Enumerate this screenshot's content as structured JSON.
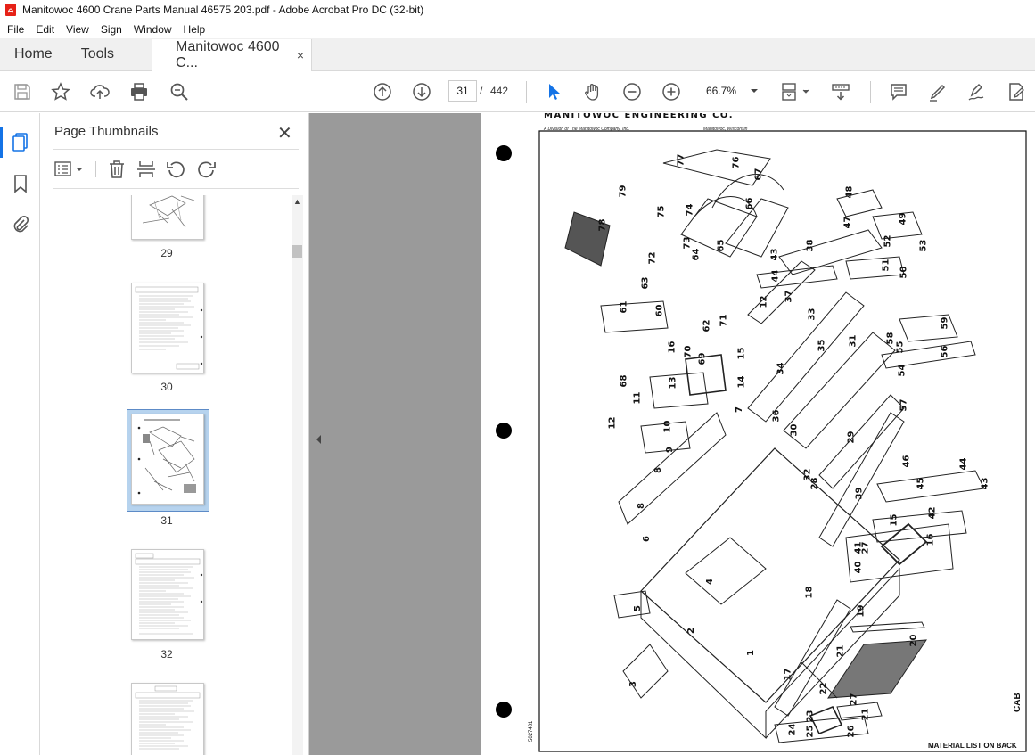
{
  "window": {
    "title": "Manitowoc 4600 Crane Parts Manual 46575 203.pdf - Adobe Acrobat Pro DC (32-bit)"
  },
  "menu": [
    "File",
    "Edit",
    "View",
    "Sign",
    "Window",
    "Help"
  ],
  "tabs": {
    "home": "Home",
    "tools": "Tools",
    "document": "Manitowoc 4600 C...",
    "close_glyph": "×"
  },
  "toolbar": {
    "current_page": "31",
    "page_separator": "/",
    "total_pages": "442",
    "zoom": "66.7%",
    "icons": [
      "save-icon",
      "bookmark-star-icon",
      "upload-icon",
      "print-icon",
      "zoom-search-icon",
      "page-up-icon",
      "page-down-icon",
      "select-arrow-icon",
      "hand-icon",
      "zoom-out-icon",
      "zoom-in-icon",
      "page-fit-icon",
      "scroll-mode-icon",
      "comment-icon",
      "highlight-icon",
      "sign-icon",
      "edit-pdf-icon"
    ]
  },
  "panel": {
    "title": "Page Thumbnails",
    "close_glyph": "✕",
    "thumbnails": [
      {
        "label": "29"
      },
      {
        "label": "30"
      },
      {
        "label": "31",
        "selected": true
      },
      {
        "label": "32"
      },
      {
        "label": ""
      }
    ]
  },
  "document": {
    "header_company": "MANITOWOC ENGINEERING CO.",
    "header_division": "A Division of The Manitowoc Company, Inc.",
    "header_location": "Manitowoc, Wisconsin",
    "footer": "MATERIAL LIST ON BACK",
    "side_code": "CAB",
    "doc_number": "5027481",
    "part_numbers": [
      "1",
      "2",
      "3",
      "4",
      "5",
      "6",
      "7",
      "8",
      "8",
      "9",
      "10",
      "11",
      "12",
      "12",
      "13",
      "14",
      "15",
      "15",
      "16",
      "16",
      "17",
      "18",
      "19",
      "20",
      "21",
      "21",
      "22",
      "23",
      "24",
      "25",
      "26",
      "27",
      "27",
      "28",
      "29",
      "30",
      "31",
      "32",
      "33",
      "34",
      "35",
      "36",
      "37",
      "38",
      "39",
      "40",
      "41",
      "42",
      "43",
      "43",
      "44",
      "44",
      "45",
      "46",
      "47",
      "48",
      "49",
      "50",
      "51",
      "52",
      "53",
      "54",
      "55",
      "56",
      "57",
      "58",
      "59",
      "60",
      "61",
      "62",
      "63",
      "64",
      "65",
      "66",
      "67",
      "68",
      "69",
      "70",
      "71",
      "72",
      "73",
      "74",
      "75",
      "76",
      "77",
      "78",
      "79",
      "80"
    ]
  },
  "colors": {
    "accent": "#1473e6",
    "doc_background": "#9a9a9a",
    "panel_selection": "#b6d3ee"
  }
}
